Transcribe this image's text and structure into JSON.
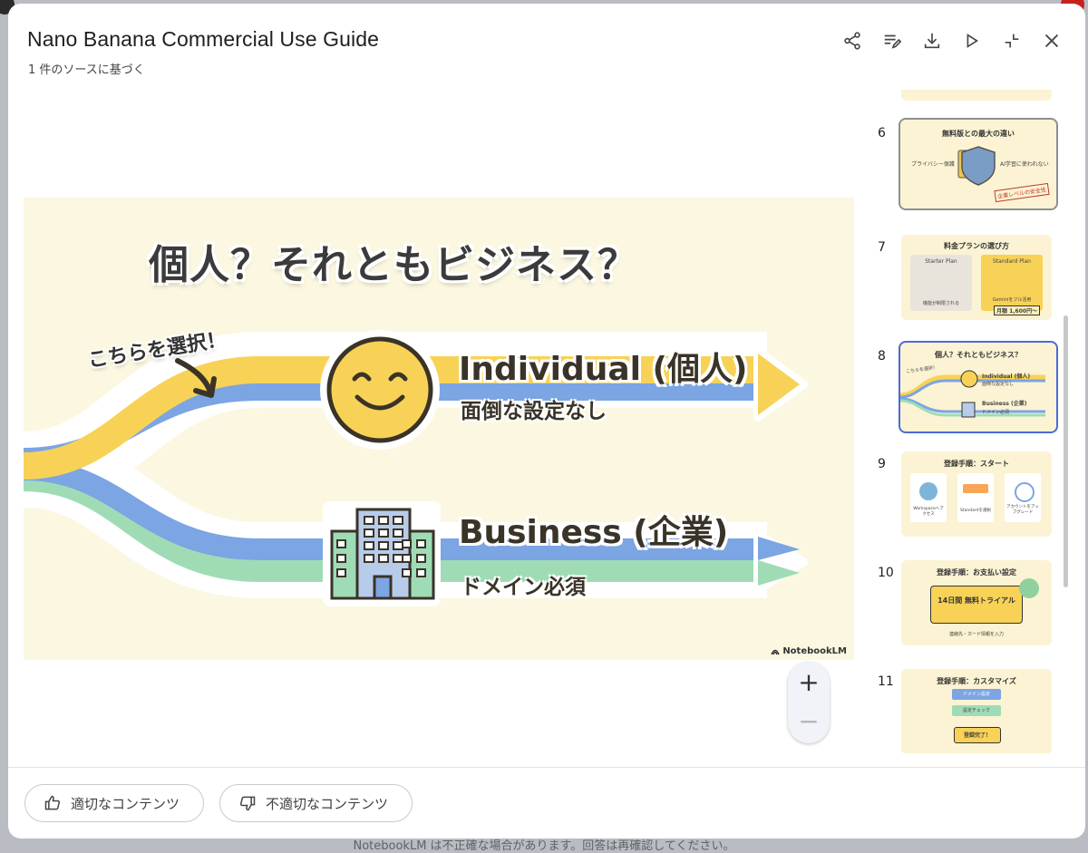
{
  "dialog": {
    "title": "Nano Banana Commercial Use Guide",
    "subtitle": "1 件のソースに基づく"
  },
  "toolbar": {
    "icons": [
      "share-icon",
      "edit-notes-icon",
      "download-icon",
      "play-icon",
      "collapse-icon",
      "close-icon"
    ]
  },
  "slide": {
    "heading": "個人？それともビジネス？",
    "callout": "こちらを選択！",
    "option_individual": {
      "title": "Individual (個人)",
      "subtitle": "面倒な設定なし"
    },
    "option_business": {
      "title": "Business (企業)",
      "subtitle": "ドメイン必須"
    },
    "brand": "NotebookLM",
    "colors": {
      "background": "#fbf7e1",
      "yellow": "#f8d257",
      "blue": "#7ba5e3",
      "green": "#9fdcb6"
    }
  },
  "zoom": {
    "plus": "+",
    "minus": "−"
  },
  "thumbnails": [
    {
      "number": "6",
      "title": "無料版との最大の違い",
      "left_label": "プライバシー保護",
      "right_label": "AI学習に使われない",
      "stamp": "企業レベルの安全性"
    },
    {
      "number": "7",
      "title": "料金プランの選び方",
      "plan_a": "Starter Plan",
      "plan_a_note": "機能が制限される",
      "plan_b": "Standard Plan",
      "plan_b_note": "Geminiをフル活用",
      "price": "月額 1,600円〜"
    },
    {
      "number": "8",
      "title": "個人？それともビジネス？",
      "callout": "こちらを選択！",
      "opt1": "Individual (個人)",
      "opt1_sub": "面倒な設定なし",
      "opt2": "Business (企業)",
      "opt2_sub": "ドメイン必須"
    },
    {
      "number": "9",
      "title": "登録手順：スタート",
      "step1": "Workspaceへアクセス",
      "step2": "Standardを選択",
      "step3": "アカウントをアップグレード"
    },
    {
      "number": "10",
      "title": "登録手順：お支払い設定",
      "ticket": "14日間 無料トライアル",
      "note": "連絡先・カード情報を入力"
    },
    {
      "number": "11",
      "title": "登録手順：カスタマイズ",
      "step1": "ドメイン設定",
      "step2": "設定チェック",
      "done": "登録完了！"
    }
  ],
  "footer": {
    "good_label": "適切なコンテンツ",
    "bad_label": "不適切なコンテンツ",
    "disclaimer": "NotebookLM は不正確な場合があります。回答は再確認してください。"
  }
}
